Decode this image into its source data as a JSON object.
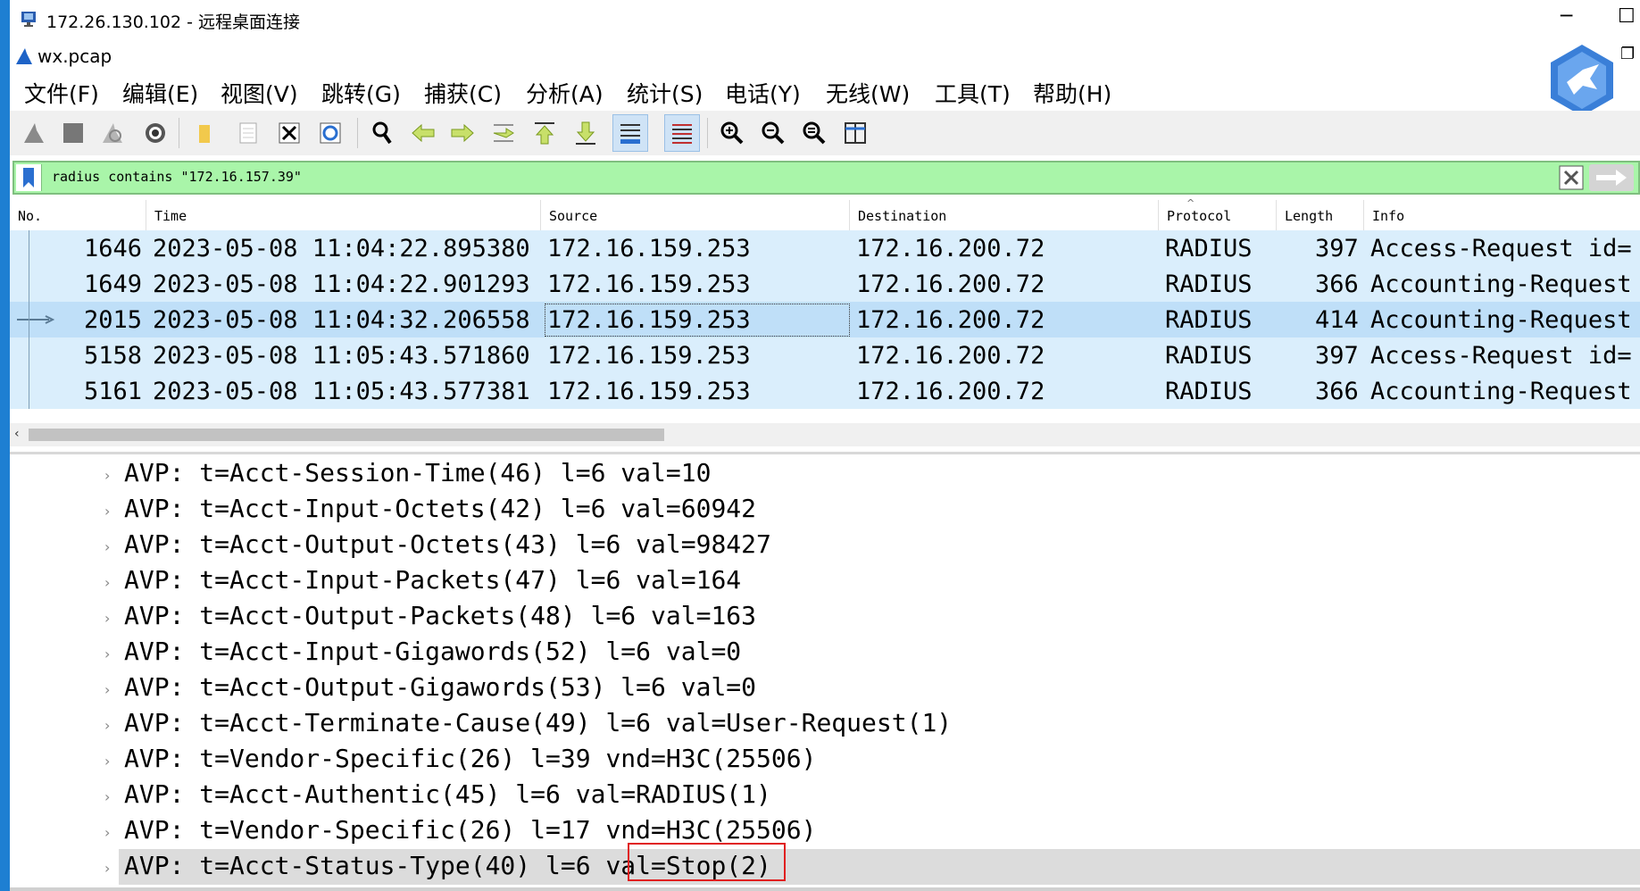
{
  "window": {
    "title": "172.26.130.102 - 远程桌面连接",
    "file": "wx.pcap",
    "minimize": "─",
    "maximize": "☐",
    "restore": "❐"
  },
  "menu": [
    "文件(F)",
    "编辑(E)",
    "视图(V)",
    "跳转(G)",
    "捕获(C)",
    "分析(A)",
    "统计(S)",
    "电话(Y)",
    "无线(W)",
    "工具(T)",
    "帮助(H)"
  ],
  "filter": {
    "value": "radius contains \"172.16.157.39\""
  },
  "columns": [
    "No.",
    "Time",
    "Source",
    "Destination",
    "Protocol",
    "Length",
    "Info"
  ],
  "packets": [
    {
      "no": "1646",
      "time": "2023-05-08 11:04:22.895380",
      "src": "172.16.159.253",
      "dst": "172.16.200.72",
      "proto": "RADIUS",
      "len": "397",
      "info": "Access-Request id="
    },
    {
      "no": "1649",
      "time": "2023-05-08 11:04:22.901293",
      "src": "172.16.159.253",
      "dst": "172.16.200.72",
      "proto": "RADIUS",
      "len": "366",
      "info": "Accounting-Request"
    },
    {
      "no": "2015",
      "time": "2023-05-08 11:04:32.206558",
      "src": "172.16.159.253",
      "dst": "172.16.200.72",
      "proto": "RADIUS",
      "len": "414",
      "info": "Accounting-Request"
    },
    {
      "no": "5158",
      "time": "2023-05-08 11:05:43.571860",
      "src": "172.16.159.253",
      "dst": "172.16.200.72",
      "proto": "RADIUS",
      "len": "397",
      "info": "Access-Request id="
    },
    {
      "no": "5161",
      "time": "2023-05-08 11:05:43.577381",
      "src": "172.16.159.253",
      "dst": "172.16.200.72",
      "proto": "RADIUS",
      "len": "366",
      "info": "Accounting-Request"
    }
  ],
  "details": [
    "AVP: t=Acct-Session-Time(46) l=6 val=10",
    "AVP: t=Acct-Input-Octets(42) l=6 val=60942",
    "AVP: t=Acct-Output-Octets(43) l=6 val=98427",
    "AVP: t=Acct-Input-Packets(47) l=6 val=164",
    "AVP: t=Acct-Output-Packets(48) l=6 val=163",
    "AVP: t=Acct-Input-Gigawords(52) l=6 val=0",
    "AVP: t=Acct-Output-Gigawords(53) l=6 val=0",
    "AVP: t=Acct-Terminate-Cause(49) l=6 val=User-Request(1)",
    "AVP: t=Vendor-Specific(26) l=39 vnd=H3C(25506)",
    "AVP: t=Acct-Authentic(45) l=6 val=RADIUS(1)",
    "AVP: t=Vendor-Specific(26) l=17 vnd=H3C(25506)",
    "AVP: t=Acct-Status-Type(40) l=6 val=Stop(2)"
  ],
  "colors": {
    "filter_bg": "#a9f5a9",
    "row_bg": "#daeefc",
    "row_selected": "#bfdff8",
    "highlight_box": "#e02020"
  }
}
